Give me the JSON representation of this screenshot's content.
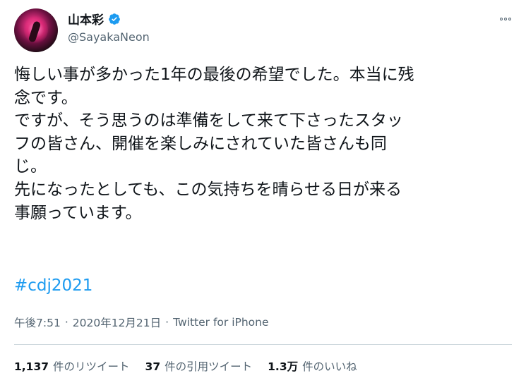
{
  "user": {
    "display_name": "山本彩",
    "handle": "@SayakaNeon",
    "verified_icon": "verified-badge-icon",
    "avatar": "profile-avatar"
  },
  "more_icon": "more-options-icon",
  "tweet": {
    "lines": [
      "悔しい事が多かった1年の最後の希望でした。本当に残",
      "念です。",
      "ですが、そう思うのは準備をして来て下さったスタッ",
      "フの皆さん、開催を楽しみにされていた皆さんも同",
      "じ。",
      "先になったとしても、この気持ちを晴らせる日が来る",
      "事願っています。"
    ],
    "hashtag": "#cdj2021"
  },
  "meta": {
    "time": "午後7:51",
    "separator": "·",
    "date": "2020年12月21日",
    "source": "Twitter for iPhone"
  },
  "stats": {
    "retweets": {
      "count": "1,137",
      "label": "件のリツイート"
    },
    "quotes": {
      "count": "37",
      "label": "件の引用ツイート"
    },
    "likes": {
      "count": "1.3万",
      "label": "件のいいね"
    }
  },
  "colors": {
    "link": "#1d9bf0",
    "muted": "#536471",
    "text": "#0f1419",
    "divider": "#cfd9de"
  }
}
